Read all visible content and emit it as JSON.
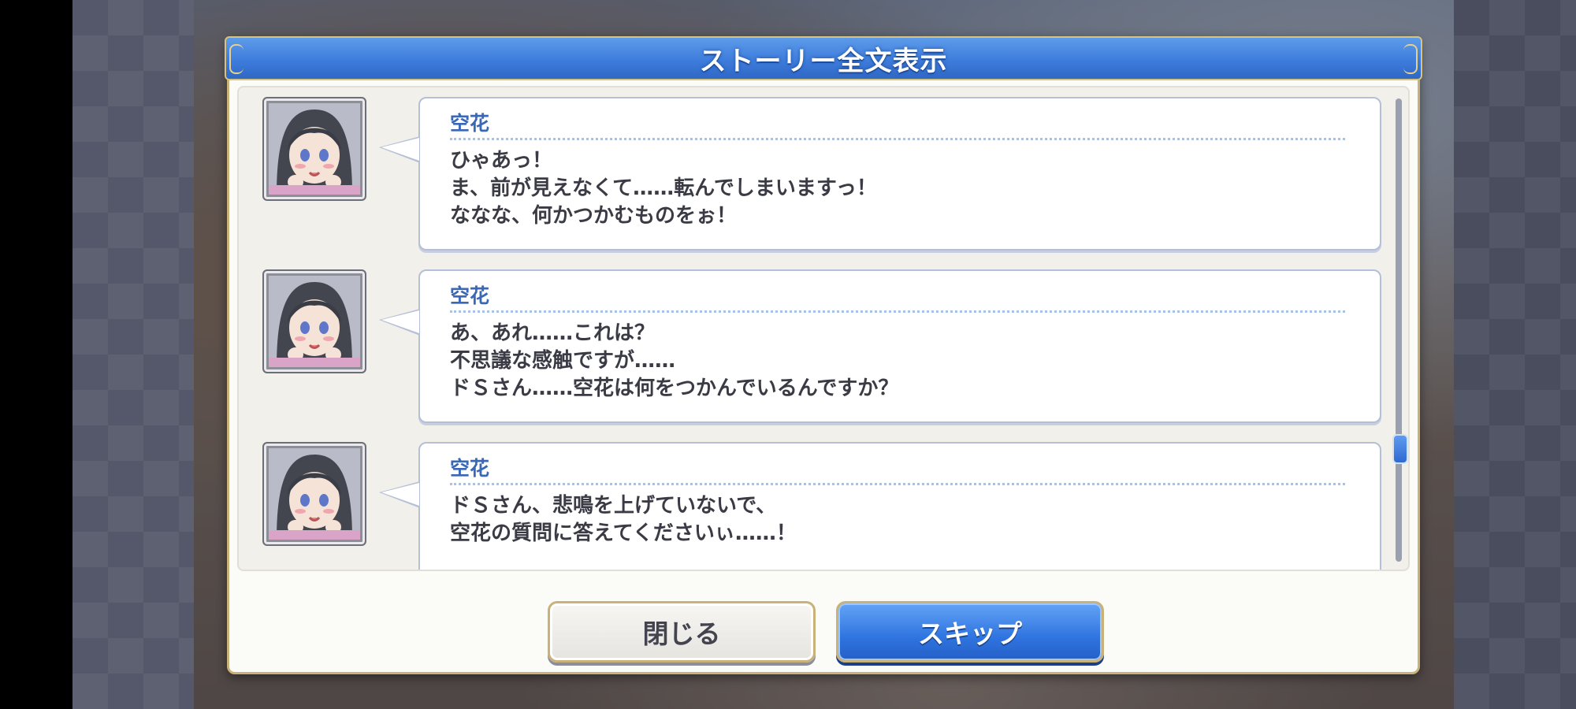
{
  "dialog": {
    "title": "ストーリー全文表示"
  },
  "entries": [
    {
      "speaker": "空花",
      "lines": [
        "ひゃあっ！",
        "ま、前が見えなくて……転んでしまいますっ！",
        "ななな、何かつかむものをぉ！"
      ]
    },
    {
      "speaker": "空花",
      "lines": [
        "あ、あれ……これは？",
        "不思議な感触ですが……",
        "ドＳさん……空花は何をつかんでいるんですか？"
      ]
    },
    {
      "speaker": "空花",
      "lines": [
        "",
        "ドＳさん、悲鳴を上げていないで、",
        "空花の質問に答えてくださいぃ……！"
      ]
    }
  ],
  "buttons": {
    "close_label": "閉じる",
    "skip_label": "スキップ"
  },
  "colors": {
    "header_blue": "#3e7ddc",
    "speaker_blue": "#3a67b6",
    "frame_gold": "#c9b27a",
    "text_dark": "#3b3b45"
  },
  "icons": {
    "avatar": "character-portrait-sorakaa"
  }
}
